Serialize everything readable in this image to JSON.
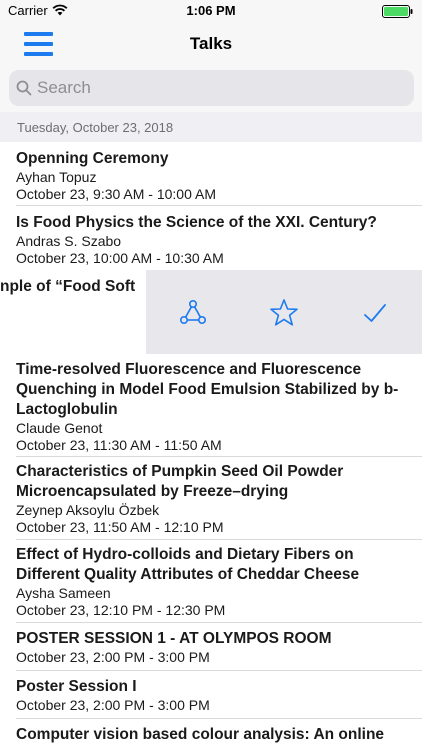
{
  "status_bar": {
    "carrier": "Carrier",
    "time": "1:06 PM"
  },
  "nav": {
    "title": "Talks",
    "menu_icon": "hamburger-menu-icon"
  },
  "search": {
    "placeholder": "Search"
  },
  "section": {
    "date": "Tuesday, October 23, 2018"
  },
  "talks": [
    {
      "title": "Openning Ceremony",
      "speaker": "Ayhan Topuz",
      "time": "October 23, 9:30 AM - 10:00 AM"
    },
    {
      "title": "Is Food Physics the Science of the XXI. Century?",
      "speaker": "Andras S. Szabo",
      "time": "October 23, 10:00 AM - 10:30 AM"
    },
    {
      "title": "Time-resolved Fluorescence and Fluorescence Quenching in Model Food Emulsion Stabilized by b-Lactoglobulin",
      "speaker": "Claude Genot",
      "time": "October 23, 11:30 AM - 11:50 AM"
    },
    {
      "title": "Characteristics of Pumpkin Seed Oil Powder Microencapsulated by Freeze–drying",
      "speaker": "Zeynep Aksoylu Özbek",
      "time": "October 23, 11:50 AM - 12:10 PM"
    },
    {
      "title": "Effect of Hydro-colloids and Dietary Fibers on Different Quality Attributes of Cheddar Cheese",
      "speaker": "Aysha Sameen",
      "time": "October 23, 12:10 PM - 12:30 PM"
    },
    {
      "title": "POSTER SESSION 1 - AT OLYMPOS ROOM",
      "time": "October 23, 2:00 PM - 3:00 PM"
    },
    {
      "title": "Poster Session I",
      "time": "October 23, 2:00 PM - 3:00 PM"
    },
    {
      "title": "Computer vision based colour analysis: An online"
    }
  ],
  "swiped_row": {
    "visible_title": "nple of “Food Soft",
    "actions": [
      "share-network-icon",
      "star-icon",
      "checkmark-icon"
    ],
    "action_color": "#1d7bf0"
  },
  "colors": {
    "accent": "#1d7bf0",
    "battery": "#4cd964"
  }
}
